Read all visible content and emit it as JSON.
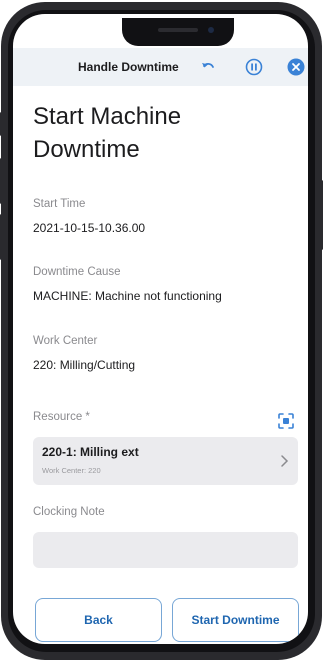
{
  "header": {
    "title": "Handle Downtime",
    "icons": [
      "undo-icon",
      "pause-icon",
      "close-icon"
    ],
    "accent_color": "#3a82d6"
  },
  "page": {
    "title_line1": "Start Machine",
    "title_line2": "Downtime"
  },
  "fields": {
    "start_time": {
      "label": "Start Time",
      "value": "2021-10-15-10.36.00"
    },
    "downtime_cause": {
      "label": "Downtime Cause",
      "value": "MACHINE: Machine not functioning"
    },
    "work_center": {
      "label": "Work Center",
      "value": "220: Milling/Cutting"
    },
    "resource": {
      "label": "Resource *",
      "value": "220-1: Milling ext",
      "sub": "Work Center: 220"
    },
    "clocking_note": {
      "label": "Clocking Note",
      "value": ""
    }
  },
  "footer": {
    "back_label": "Back",
    "start_label": "Start Downtime"
  }
}
